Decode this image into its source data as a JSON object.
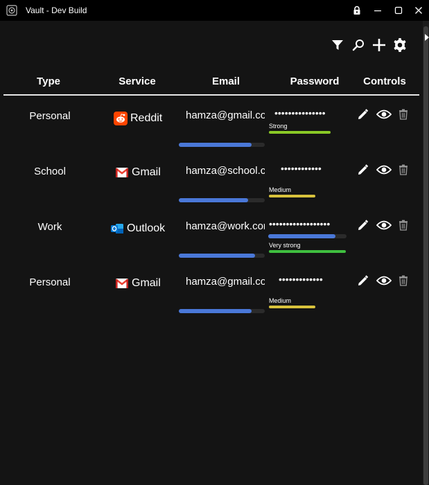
{
  "window": {
    "title": "Vault - Dev Build",
    "buttons": [
      "lock-icon",
      "minimize-icon",
      "maximize-icon",
      "close-icon"
    ]
  },
  "toolbar": {
    "icons": [
      "filter-icon",
      "search-icon",
      "add-icon",
      "settings-icon"
    ]
  },
  "table": {
    "headers": {
      "type": "Type",
      "service": "Service",
      "email": "Email",
      "password": "Password",
      "controls": "Controls"
    },
    "rows": [
      {
        "type": "Personal",
        "service": "Reddit",
        "service_icon": "reddit-icon",
        "email": "hamza@gmail.com",
        "password_mask": "•••••••••••••••",
        "email_progress": 0.85,
        "strength": "Strong",
        "strength_color": "#8ac926",
        "strength_level": 0.8
      },
      {
        "type": "School",
        "service": "Gmail",
        "service_icon": "gmail-icon",
        "email": "hamza@school.com",
        "password_mask": "••••••••••••",
        "email_progress": 0.81,
        "strength": "Medium",
        "strength_color": "#d8c23c",
        "strength_level": 0.6
      },
      {
        "type": "Work",
        "service": "Outlook",
        "service_icon": "outlook-icon",
        "email": "hamza@work.com",
        "password_mask": "••••••••••••••••••",
        "email_progress": 0.89,
        "password_progress": 0.86,
        "strength": "Very strong",
        "strength_color": "#3fbf3f",
        "strength_level": 1.0
      },
      {
        "type": "Personal",
        "service": "Gmail",
        "service_icon": "gmail-icon",
        "email": "hamza@gmail.com",
        "password_mask": "•••••••••••••",
        "email_progress": 0.85,
        "strength": "Medium",
        "strength_color": "#d8c23c",
        "strength_level": 0.6
      }
    ],
    "controls": [
      "edit-icon",
      "view-icon",
      "delete-icon"
    ]
  },
  "colors": {
    "background": "#141414",
    "titlebar": "#000000",
    "bar_fill": "#4a78d8",
    "bar_track": "#2b2b2b",
    "divider": "#e6e6e6"
  }
}
